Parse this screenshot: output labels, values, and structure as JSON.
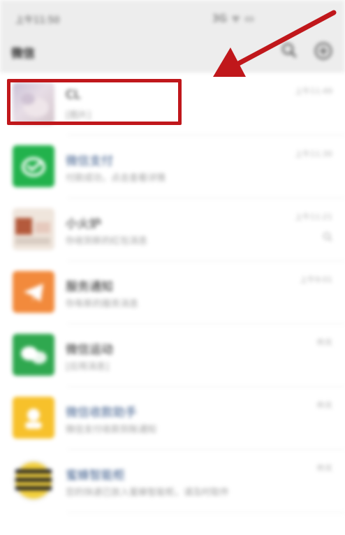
{
  "status_bar": {
    "time": "上午11:50",
    "icons": "3G ᯤ ▭"
  },
  "header": {
    "title": "微信",
    "search_icon": "search-icon",
    "add_icon": "add-circle-icon"
  },
  "chats": [
    {
      "name": "CL",
      "preview": "[图片]",
      "time": "上午11:49",
      "avatar": "photo-avatar",
      "name_style": "dark",
      "muted": false
    },
    {
      "name": "微信支付",
      "preview": "付款成功，点击查看详情",
      "time": "上午11:30",
      "avatar": "wechat-pay-icon",
      "avatar_color": "#22b24c",
      "name_style": "link",
      "muted": false
    },
    {
      "name": "小火炉",
      "preview": "你收到新的红包消息",
      "time": "上午11:21",
      "avatar": "photo-avatar",
      "name_style": "dark",
      "muted": true
    },
    {
      "name": "服务通知",
      "preview": "你有新的服务消息",
      "time": "上午9:01",
      "avatar": "service-notice-icon",
      "avatar_color": "#f28a3c",
      "name_style": "dark",
      "muted": false
    },
    {
      "name": "微信运动",
      "preview": "[应用消息]",
      "time": "昨天",
      "avatar": "wechat-sport-icon",
      "avatar_color": "#2fa84f",
      "name_style": "dark",
      "muted": false
    },
    {
      "name": "微信收款助手",
      "preview": "微信支付收款到账通知",
      "time": "昨天",
      "avatar": "wechat-receipt-icon",
      "avatar_color": "#f7c12b",
      "name_style": "link",
      "muted": false
    },
    {
      "name": "蜜蜂智能柜",
      "preview": "您的快递已放入蜜蜂智能柜，请及时取件",
      "time": "昨天",
      "avatar": "bee-locker-icon",
      "avatar_color": "#222222",
      "name_style": "link",
      "muted": false
    }
  ],
  "annotation": {
    "box_color": "#c0171b",
    "arrow_color": "#c0171b"
  }
}
